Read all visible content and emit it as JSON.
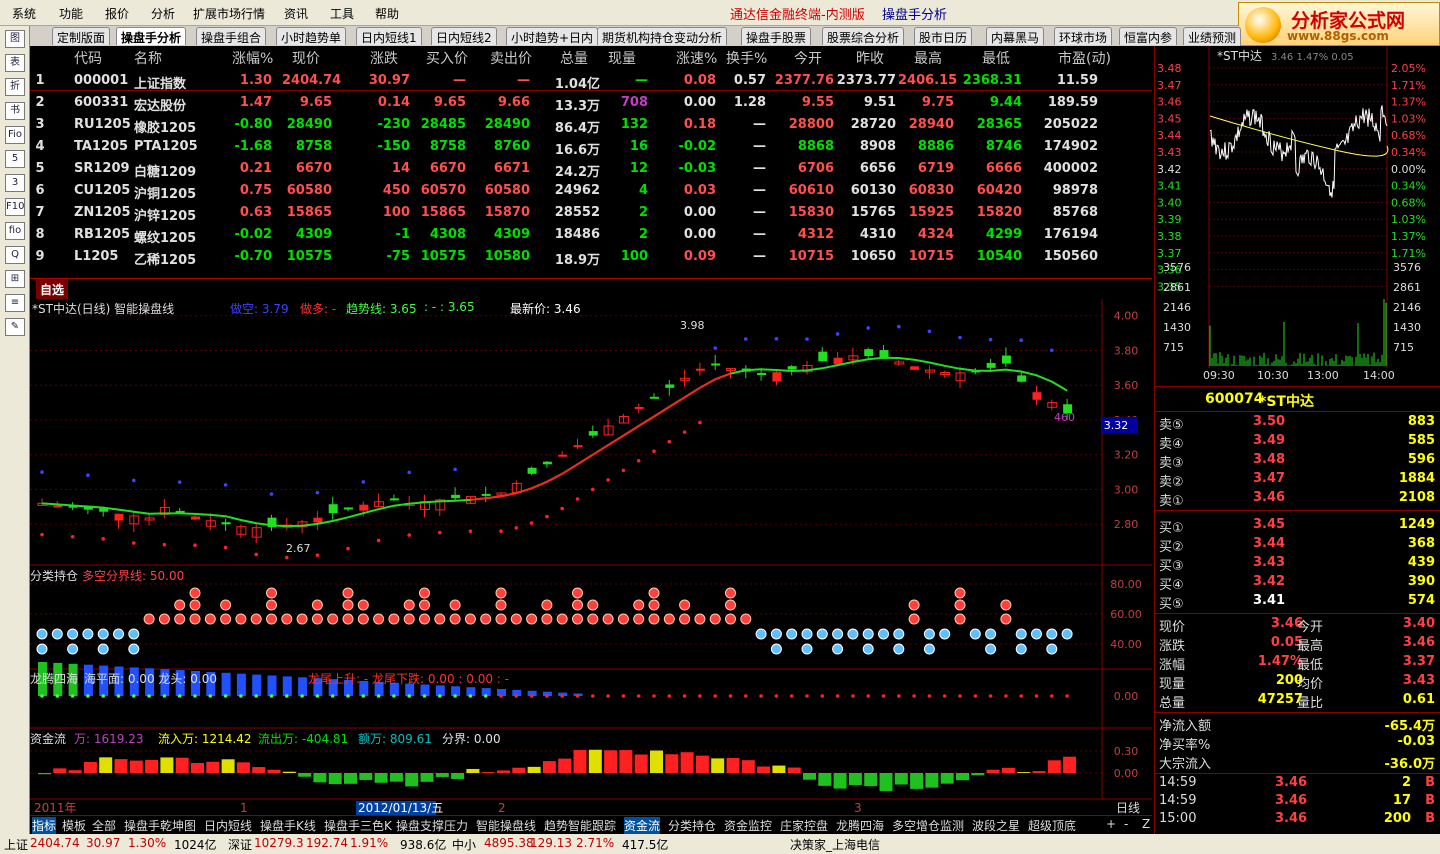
{
  "menubar": {
    "items": [
      "系统",
      "功能",
      "报价",
      "分析",
      "扩展市场行情",
      "资讯",
      "工具",
      "帮助"
    ],
    "title": "通达信金融终端-内测版",
    "subtitle": "操盘手分析"
  },
  "logo": {
    "line1": "分析家公式网",
    "line2": "www.88gs.com"
  },
  "tabs": [
    "定制版面",
    "操盘手分析",
    "操盘手组合",
    "小时趋势单",
    "日内短线1",
    "日内短线2",
    "小时趋势+日内",
    "期货机构持仓变动分析",
    "操盘手股票",
    "股票综合分析",
    "股市日历",
    "内幕黑马",
    "环球市场",
    "恒富内参",
    "业绩预测"
  ],
  "lefttool": [
    "图",
    "表",
    "折",
    "书",
    "Fio",
    "5",
    "3",
    "F10",
    "fio",
    "Q",
    "⊞",
    "≡",
    "✎"
  ],
  "quotes": {
    "headers": [
      "代码",
      "名称",
      "涨幅%",
      "现价",
      "涨跌",
      "买入价",
      "卖出价",
      "总量",
      "现量",
      "涨速%",
      "换手%",
      "今开",
      "昨收",
      "最高",
      "最低",
      "市盈(动)"
    ],
    "rows": [
      [
        "1",
        "000001",
        "上证指数",
        "1.30",
        "2404.74",
        "30.97",
        "—",
        "—",
        "1.04亿",
        "—",
        "0.08",
        "0.57",
        "2377.76",
        "2373.77",
        "2406.15",
        "2368.31",
        "11.59"
      ],
      [
        "2",
        "600331",
        "宏达股份",
        "1.47",
        "9.65",
        "0.14",
        "9.65",
        "9.66",
        "13.3万",
        "708",
        "0.00",
        "1.28",
        "9.55",
        "9.51",
        "9.75",
        "9.44",
        "189.59"
      ],
      [
        "3",
        "RU1205",
        "橡胶1205",
        "-0.80",
        "28490",
        "-230",
        "28485",
        "28490",
        "86.4万",
        "132",
        "0.18",
        "—",
        "28800",
        "28720",
        "28940",
        "28365",
        "205022"
      ],
      [
        "4",
        "TA1205",
        "PTA1205",
        "-1.68",
        "8758",
        "-150",
        "8758",
        "8760",
        "16.6万",
        "16",
        "-0.02",
        "—",
        "8868",
        "8908",
        "8886",
        "8746",
        "174902"
      ],
      [
        "5",
        "SR1209",
        "白糖1209",
        "0.21",
        "6670",
        "14",
        "6670",
        "6671",
        "24.2万",
        "12",
        "-0.03",
        "—",
        "6706",
        "6656",
        "6719",
        "6666",
        "400002"
      ],
      [
        "6",
        "CU1205",
        "沪铜1205",
        "0.75",
        "60580",
        "450",
        "60570",
        "60580",
        "24962",
        "4",
        "0.03",
        "—",
        "60610",
        "60130",
        "60830",
        "60420",
        "98978"
      ],
      [
        "7",
        "ZN1205",
        "沪锌1205",
        "0.63",
        "15865",
        "100",
        "15865",
        "15870",
        "28552",
        "2",
        "0.00",
        "—",
        "15830",
        "15765",
        "15925",
        "15820",
        "85768"
      ],
      [
        "8",
        "RB1205",
        "螺纹1205",
        "-0.02",
        "4309",
        "-1",
        "4308",
        "4309",
        "18486",
        "2",
        "0.00",
        "—",
        "4312",
        "4310",
        "4324",
        "4299",
        "176194"
      ],
      [
        "9",
        "L1205",
        "乙稀1205",
        "-0.70",
        "10575",
        "-75",
        "10575",
        "10580",
        "18.9万",
        "100",
        "0.09",
        "—",
        "10715",
        "10650",
        "10715",
        "10540",
        "150560"
      ]
    ]
  },
  "kline": {
    "tag": "自选",
    "title": "*ST中达(日线) 智能操盘线",
    "legend": [
      {
        "t": "做空: 3.79",
        "c": "#4040ff"
      },
      {
        "t": "做多: -",
        "c": "#ff3030"
      },
      {
        "t": "趋势线: 3.65",
        "c": "#40ff40"
      },
      {
        "t": ": - : 3.65",
        "c": "#40ff40"
      },
      {
        "t": "最新价: 3.46",
        "c": "#ffffff"
      }
    ],
    "yticks": [
      "4.00",
      "3.80",
      "3.60",
      "3.40",
      "3.20",
      "3.00",
      "2.80"
    ],
    "hi_label": "3.98",
    "lo_label": "2.67",
    "last_label": "460",
    "price_tag": "3.32",
    "sub1_title": "分类持仓",
    "sub1_line": "多空分界线: 50.00",
    "sub1_ticks": [
      "80.00",
      "60.00",
      "40.00"
    ],
    "sub2_title": "龙腾四海",
    "sub2_legend": "海平面: 0.00  龙头: 0.00",
    "sub2_legend2": "龙尾上升: -  龙尾下跌: 0.00 : 0.00 : -",
    "sub2_ticks": [
      "0.00"
    ],
    "sub3_title": "资金流",
    "sub3_items": [
      {
        "t": "万: 1619.23",
        "c": "#c040c0"
      },
      {
        "t": "流入万: 1214.42",
        "c": "#ffff00"
      },
      {
        "t": "流出万: -404.81",
        "c": "#00e000"
      },
      {
        "t": "额万: 809.61",
        "c": "#00c0c0"
      },
      {
        "t": "分界: 0.00",
        "c": "#e0e0e0"
      }
    ],
    "sub3_ticks": [
      "0.30",
      "0.00"
    ],
    "xaxis": [
      "2011年",
      "1",
      "2012/01/13/五",
      "2",
      "3"
    ],
    "period": "日线"
  },
  "bottomtabs": [
    "指标",
    "模板",
    "全部",
    "操盘手乾坤图",
    "日内短线",
    "操盘手K线",
    "操盘手三色K",
    "操盘支撑压力",
    "智能操盘线",
    "趋势智能跟踪",
    "资金流",
    "分类持仓",
    "资金监控",
    "庄家控盘",
    "龙腾四海",
    "多空增仓监测",
    "波段之星",
    "超级顶底"
  ],
  "bottom_controls": [
    "+",
    "-",
    "Z"
  ],
  "status": [
    {
      "t": "上证",
      "c": "#000"
    },
    {
      "t": "2404.74",
      "c": "#c00000"
    },
    {
      "t": "30.97",
      "c": "#c00000"
    },
    {
      "t": "1.30%",
      "c": "#c00000"
    },
    {
      "t": "1024亿",
      "c": "#000"
    },
    {
      "t": "深证",
      "c": "#000"
    },
    {
      "t": "10279.3",
      "c": "#c00000"
    },
    {
      "t": "192.74",
      "c": "#c00000"
    },
    {
      "t": "1.91%",
      "c": "#c00000"
    },
    {
      "t": "938.6亿",
      "c": "#000"
    },
    {
      "t": "中小",
      "c": "#000"
    },
    {
      "t": "4895.38",
      "c": "#c00000"
    },
    {
      "t": "129.13",
      "c": "#c00000"
    },
    {
      "t": "2.71%",
      "c": "#c00000"
    },
    {
      "t": "417.5亿",
      "c": "#000"
    },
    {
      "t": "决策家_上海电信",
      "c": "#000"
    }
  ],
  "right": {
    "mini_title": "*ST中达",
    "mini_hdr": "3.46  1.47%  0.05",
    "mini_left": [
      "3.48",
      "3.47",
      "3.46",
      "3.45",
      "3.44",
      "3.43",
      "3.42",
      "3.41",
      "3.40",
      "3.39",
      "3.38",
      "3.37",
      "3.36",
      "3.35"
    ],
    "mini_right": [
      "2.05%",
      "1.71%",
      "1.37%",
      "1.03%",
      "0.68%",
      "0.34%",
      "0.00%",
      "0.34%",
      "0.68%",
      "1.03%",
      "1.37%",
      "1.71%"
    ],
    "vol_ticks": [
      "3576",
      "2861",
      "2146",
      "1430",
      "715"
    ],
    "times": [
      "09:30",
      "10:30",
      "13:00",
      "14:00"
    ],
    "stock_code": "600074",
    "stock_name": "*ST中达",
    "sells": [
      [
        "卖⑤",
        "3.50",
        "883"
      ],
      [
        "卖④",
        "3.49",
        "585"
      ],
      [
        "卖③",
        "3.48",
        "596"
      ],
      [
        "卖②",
        "3.47",
        "1884"
      ],
      [
        "卖①",
        "3.46",
        "2108"
      ]
    ],
    "buys": [
      [
        "买①",
        "3.45",
        "1249"
      ],
      [
        "买②",
        "3.44",
        "368"
      ],
      [
        "买③",
        "3.43",
        "439"
      ],
      [
        "买④",
        "3.42",
        "390"
      ],
      [
        "买⑤",
        "3.41",
        "574"
      ]
    ],
    "stats": [
      [
        "现价",
        "3.46",
        "今开",
        "3.40"
      ],
      [
        "涨跌",
        "0.05",
        "最高",
        "3.46"
      ],
      [
        "涨幅",
        "1.47%",
        "最低",
        "3.37"
      ],
      [
        "现量",
        "200",
        "均价",
        "3.43"
      ],
      [
        "总量",
        "47257",
        "量比",
        "0.61"
      ]
    ],
    "flows": [
      [
        "净流入额",
        "-65.4万"
      ],
      [
        "净买率%",
        "-0.03"
      ],
      [
        "大宗流入",
        "-36.0万"
      ]
    ],
    "ticks": [
      [
        "14:59",
        "3.46",
        "2",
        "B"
      ],
      [
        "14:59",
        "3.46",
        "17",
        "B"
      ],
      [
        "15:00",
        "3.46",
        "200",
        "B"
      ]
    ]
  }
}
